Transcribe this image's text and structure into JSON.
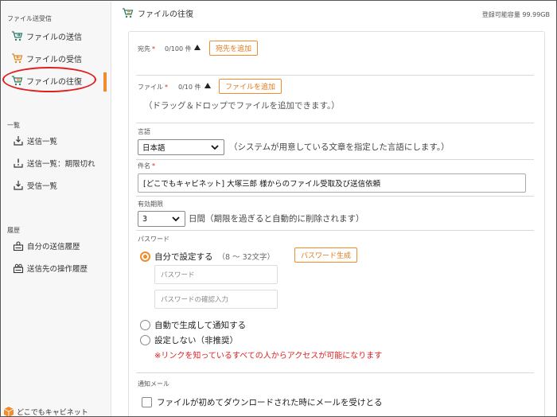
{
  "sidebar": {
    "section_transfer": "ファイル送受信",
    "items_transfer": [
      {
        "label": "ファイルの送信",
        "icon": "cart-send-icon"
      },
      {
        "label": "ファイルの受信",
        "icon": "cart-receive-icon"
      },
      {
        "label": "ファイルの往復",
        "icon": "cart-roundtrip-icon"
      }
    ],
    "section_list": "一覧",
    "items_list": [
      {
        "label": "送信一覧",
        "icon": "tray-download-icon"
      },
      {
        "label": "送信一覧：期限切れ",
        "icon": "tray-alert-icon"
      },
      {
        "label": "受信一覧",
        "icon": "tray-download-icon"
      }
    ],
    "section_history": "履歴",
    "items_history": [
      {
        "label": "自分の送信履歴",
        "icon": "user-history-icon"
      },
      {
        "label": "送信先の操作履歴",
        "icon": "users-history-icon"
      }
    ],
    "brand": "どこでもキャビネット",
    "accent": "#f08c2c",
    "annotation_color": "#e02020"
  },
  "header": {
    "title": "ファイルの往復",
    "capacity": "登録可能容量 99.99GB"
  },
  "form": {
    "recipients": {
      "label": "宛先",
      "required_mark": "*",
      "count": "0/100 件",
      "add_button": "宛先を追加"
    },
    "files": {
      "label": "ファイル",
      "required_mark": "*",
      "count": "0/10 件",
      "add_button": "ファイルを追加",
      "drop_hint": "（ドラッグ＆ドロップでファイルを追加できます。）"
    },
    "language": {
      "label": "言語",
      "value": "日本語",
      "hint": "（システムが用意している文章を指定した言語にします。）"
    },
    "subject": {
      "label": "件名",
      "required_mark": "*",
      "value": "[どこでもキャビネット] 大塚三郎 様からのファイル受取及び送信依頼"
    },
    "expiry": {
      "label": "有効期限",
      "value": "3",
      "unit": "日間",
      "hint": "（期限を過ぎると自動的に削除されます）"
    },
    "password": {
      "label": "パスワード",
      "option_self": "自分で設定する",
      "option_self_note": "（8 〜 32文字）",
      "generate_button": "パスワード生成",
      "password_placeholder": "パスワード",
      "confirm_placeholder": "パスワードの確認入力",
      "option_auto": "自動で生成して通知する",
      "option_none": "設定しない（非推奨）",
      "warning": "※リンクを知っているすべての人からアクセスが可能になります"
    },
    "notify": {
      "label": "通知メール",
      "option_first_download": "ファイルが初めてダウンロードされた時にメールを受けとる"
    }
  }
}
